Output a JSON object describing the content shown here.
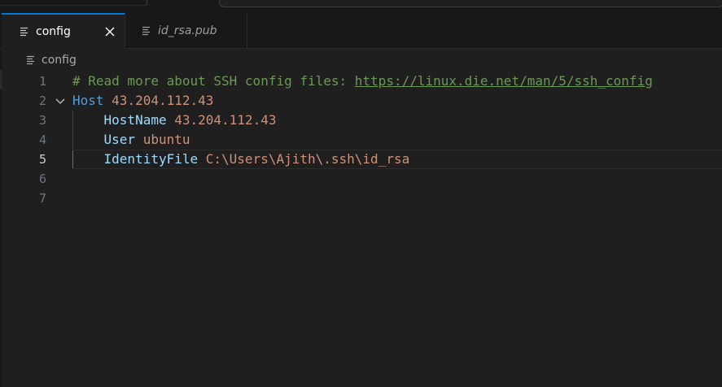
{
  "tabs": [
    {
      "label": "config",
      "active": true,
      "close_icon": "close-icon"
    },
    {
      "label": "id_rsa.pub",
      "active": false
    }
  ],
  "breadcrumb": {
    "label": "config",
    "icon": "file-lines-icon"
  },
  "editor": {
    "current_line": 5,
    "lines": [
      {
        "number": "1",
        "comment": "# Read more about SSH config files: ",
        "link": "https://linux.die.net/man/5/ssh_config"
      },
      {
        "number": "2",
        "keyword": "Host",
        "value": "43.204.112.43",
        "foldable": true
      },
      {
        "number": "3",
        "key": "HostName",
        "value": "43.204.112.43"
      },
      {
        "number": "4",
        "key": "User",
        "value": "ubuntu"
      },
      {
        "number": "5",
        "key": "IdentityFile",
        "value": "C:\\Users\\Ajith\\.ssh\\id_rsa"
      },
      {
        "number": "6"
      },
      {
        "number": "7"
      }
    ]
  },
  "colors": {
    "background": "#1f1f1f",
    "accent": "#0078d4",
    "comment": "#6a9955",
    "keyword": "#569cd6",
    "key": "#9cdcfe",
    "value": "#ce9178"
  }
}
